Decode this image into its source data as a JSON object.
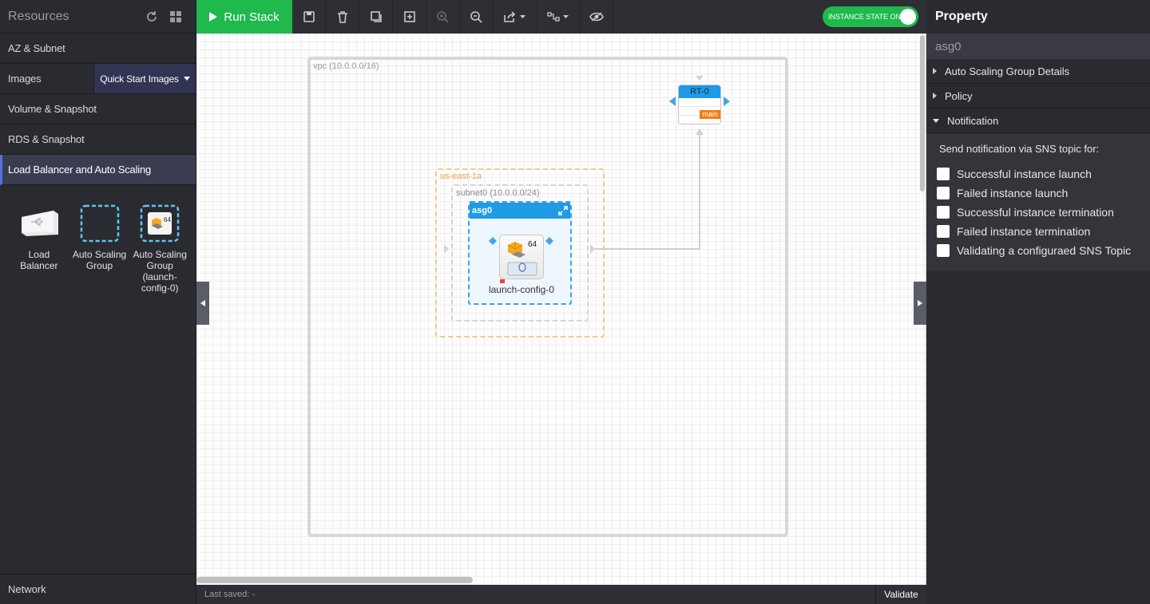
{
  "left_panel": {
    "title": "Resources",
    "accordion": [
      {
        "label": "AZ & Subnet"
      },
      {
        "label": "Images"
      },
      {
        "label": "Volume & Snapshot"
      },
      {
        "label": "RDS & Snapshot"
      },
      {
        "label": "Load Balancer and Auto Scaling"
      }
    ],
    "images_dropdown": "Quick Start Images",
    "resources": [
      {
        "label": "Load Balancer",
        "icon": "load-balancer-icon"
      },
      {
        "label": "Auto Scaling Group",
        "icon": "asg-empty-icon"
      },
      {
        "label": "Auto Scaling Group (launch-config-0)",
        "icon": "asg-launch-config-icon"
      }
    ],
    "network_label": "Network"
  },
  "toolbar": {
    "run_label": "Run Stack",
    "instance_state": "INSTANCE STATE ON"
  },
  "canvas": {
    "vpc_label": "vpc (10.0.0.0/16)",
    "az_label": "us-east-1a",
    "subnet_label": "subnet0 (10.0.0.0/24)",
    "asg_label": "asg0",
    "launch_config_label": "launch-config-0",
    "ami_badge": "64",
    "route_table_label": "RT-0",
    "route_table_tag": "main"
  },
  "status": {
    "last_saved": "Last saved: -",
    "validate_label": "Validate"
  },
  "right_panel": {
    "title": "Property",
    "selected": "asg0",
    "sections": [
      {
        "label": "Auto Scaling Group Details",
        "expanded": false
      },
      {
        "label": "Policy",
        "expanded": false
      },
      {
        "label": "Notification",
        "expanded": true
      }
    ],
    "notification_heading": "Send notification via SNS topic for:",
    "notification_options": [
      {
        "label": "Successful instance launch",
        "checked": false
      },
      {
        "label": "Failed instance launch",
        "checked": false
      },
      {
        "label": "Successful instance termination",
        "checked": false
      },
      {
        "label": "Failed instance termination",
        "checked": false
      },
      {
        "label": "Validating a configuraed SNS Topic",
        "checked": false
      }
    ]
  },
  "colors": {
    "accent_green": "#1fb94c",
    "accent_blue": "#1e9be4",
    "az_orange": "#f0a04b"
  }
}
